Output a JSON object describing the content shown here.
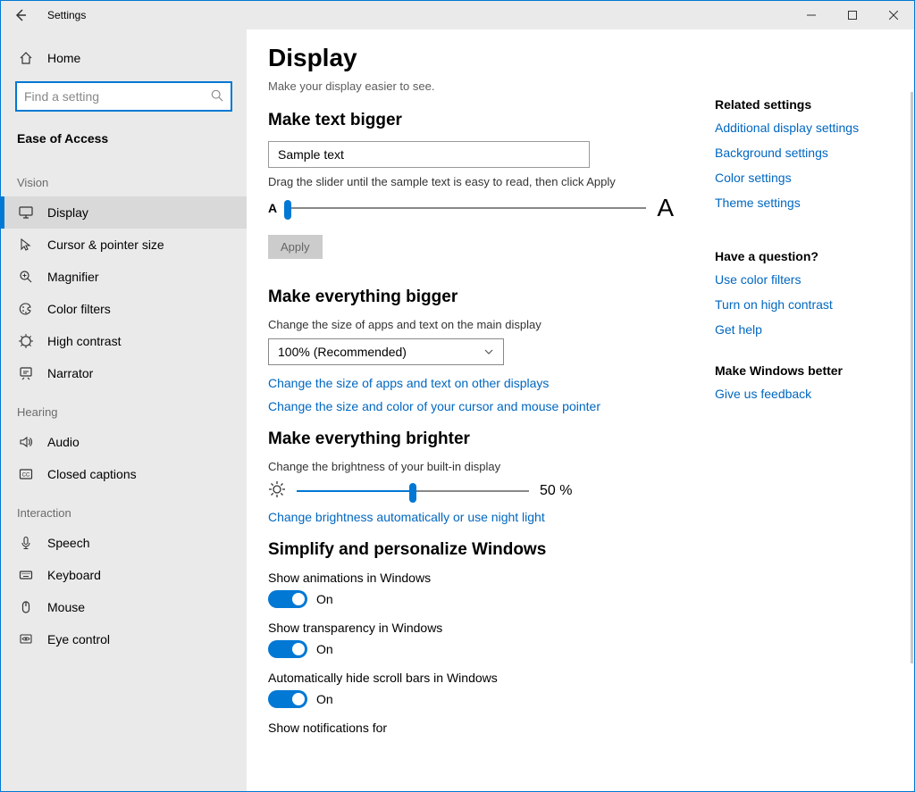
{
  "window": {
    "title": "Settings"
  },
  "sidebar": {
    "home": "Home",
    "search_placeholder": "Find a setting",
    "section": "Ease of Access",
    "groups": [
      {
        "label": "Vision",
        "items": [
          {
            "id": "display",
            "label": "Display",
            "selected": true,
            "icon": "monitor"
          },
          {
            "id": "cursor",
            "label": "Cursor & pointer size",
            "selected": false,
            "icon": "cursor"
          },
          {
            "id": "magnifier",
            "label": "Magnifier",
            "selected": false,
            "icon": "magnify"
          },
          {
            "id": "filters",
            "label": "Color filters",
            "selected": false,
            "icon": "palette"
          },
          {
            "id": "contrast",
            "label": "High contrast",
            "selected": false,
            "icon": "contrast"
          },
          {
            "id": "narrator",
            "label": "Narrator",
            "selected": false,
            "icon": "narrator"
          }
        ]
      },
      {
        "label": "Hearing",
        "items": [
          {
            "id": "audio",
            "label": "Audio",
            "selected": false,
            "icon": "audio"
          },
          {
            "id": "cc",
            "label": "Closed captions",
            "selected": false,
            "icon": "cc"
          }
        ]
      },
      {
        "label": "Interaction",
        "items": [
          {
            "id": "speech",
            "label": "Speech",
            "selected": false,
            "icon": "mic"
          },
          {
            "id": "keyboard",
            "label": "Keyboard",
            "selected": false,
            "icon": "keyboard"
          },
          {
            "id": "mouse",
            "label": "Mouse",
            "selected": false,
            "icon": "mouse"
          },
          {
            "id": "eye",
            "label": "Eye control",
            "selected": false,
            "icon": "eye"
          }
        ]
      }
    ]
  },
  "main": {
    "title": "Display",
    "subtitle": "Make your display easier to see.",
    "sec1": {
      "heading": "Make text bigger",
      "sample": "Sample text",
      "hint": "Drag the slider until the sample text is easy to read, then click Apply",
      "a_small": "A",
      "a_big": "A",
      "apply": "Apply"
    },
    "sec2": {
      "heading": "Make everything bigger",
      "desc": "Change the size of apps and text on the main display",
      "selected": "100% (Recommended)",
      "link1": "Change the size of apps and text on other displays",
      "link2": "Change the size and color of your cursor and mouse pointer"
    },
    "sec3": {
      "heading": "Make everything brighter",
      "desc": "Change the brightness of your built-in display",
      "value": "50 %",
      "percent": 50,
      "link": "Change brightness automatically or use night light"
    },
    "sec4": {
      "heading": "Simplify and personalize Windows",
      "toggles": [
        {
          "label": "Show animations in Windows",
          "state": "On"
        },
        {
          "label": "Show transparency in Windows",
          "state": "On"
        },
        {
          "label": "Automatically hide scroll bars in Windows",
          "state": "On"
        }
      ],
      "cutoff": "Show notifications for"
    }
  },
  "aside": {
    "related_header": "Related settings",
    "related": [
      "Additional display settings",
      "Background settings",
      "Color settings",
      "Theme settings"
    ],
    "question_header": "Have a question?",
    "question": [
      "Use color filters",
      "Turn on high contrast",
      "Get help"
    ],
    "better_header": "Make Windows better",
    "better": [
      "Give us feedback"
    ]
  }
}
